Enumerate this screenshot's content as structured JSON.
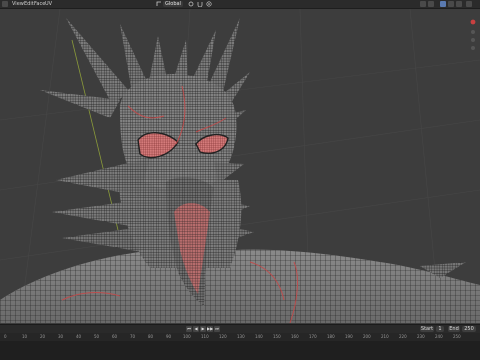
{
  "menu": [
    "View",
    "Edit",
    "Face",
    "UV"
  ],
  "header": {
    "mode": "Global"
  },
  "playback": {
    "buttons": [
      "⏮",
      "◀",
      "▶",
      "▶▶",
      "⏭"
    ]
  },
  "timeline": {
    "start_label": "Start",
    "start": "1",
    "end_label": "End",
    "end": "250",
    "ticks": [
      "0",
      "10",
      "20",
      "30",
      "40",
      "50",
      "60",
      "70",
      "80",
      "90",
      "100",
      "110",
      "120",
      "130",
      "140",
      "150",
      "160",
      "170",
      "180",
      "190",
      "200",
      "210",
      "220",
      "230",
      "240",
      "250"
    ]
  },
  "colors": {
    "accent": "#c94040",
    "mesh": "#7c7c7c",
    "wire": "#1a1a1a",
    "seam": "#c34a4a",
    "viewport_bg": "#3d3d3d"
  },
  "icons": [
    "editor-type-icon",
    "select-mode-icon",
    "transform-orientation-icon",
    "pivot-icon",
    "snap-icon",
    "proportional-edit-icon",
    "overlay-icon",
    "xray-icon",
    "shading-solid-icon",
    "shading-material-icon",
    "shading-rendered-icon",
    "navigation-gizmo"
  ]
}
